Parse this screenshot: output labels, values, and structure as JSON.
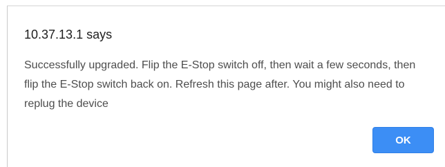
{
  "dialog": {
    "title": "10.37.13.1 says",
    "message": "Successfully upgraded. Flip the E-Stop switch off, then wait a few seconds, then flip the E-Stop switch back on. Refresh this page after. You might also need to replug the device",
    "ok_label": "OK"
  },
  "colors": {
    "accent": "#3c8ef5",
    "title_text": "#202020",
    "message_text": "#4d4d4d"
  }
}
